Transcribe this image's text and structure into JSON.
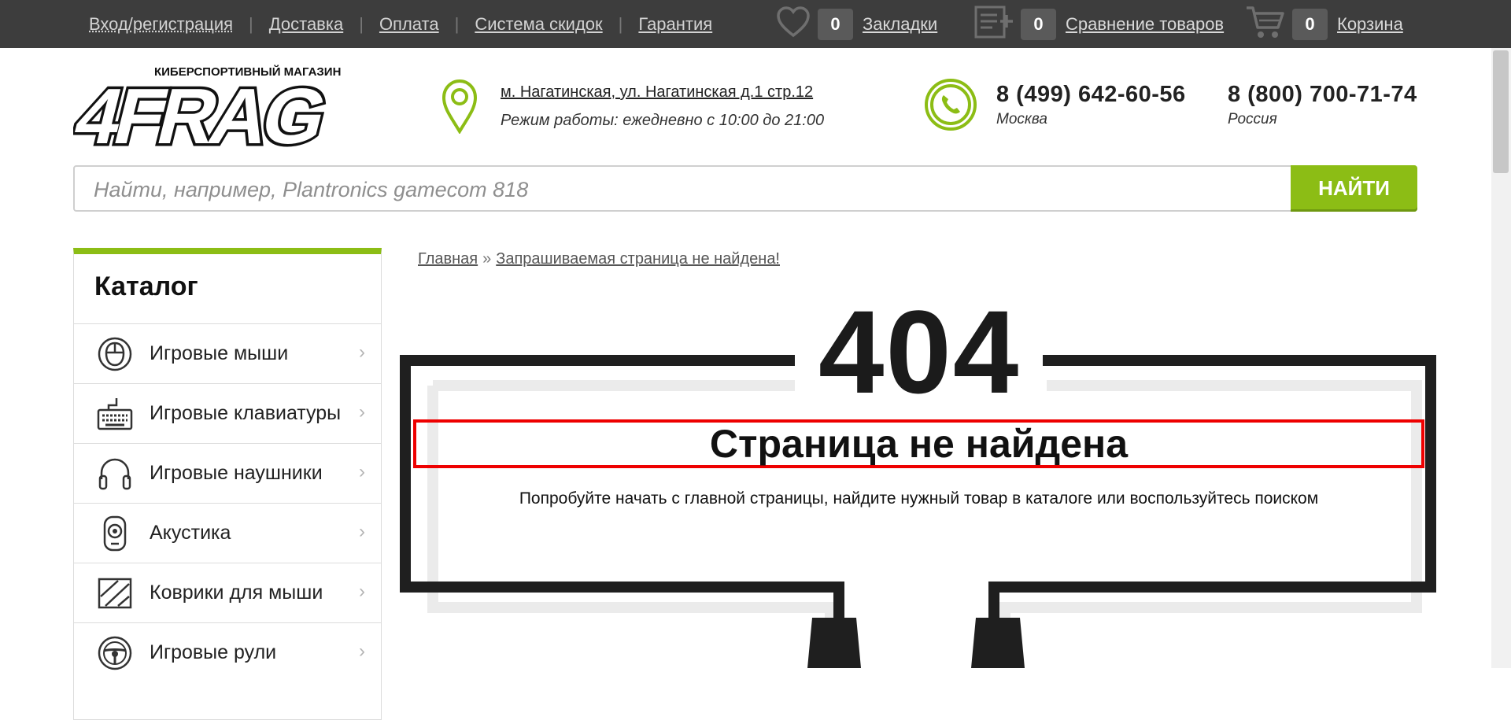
{
  "topbar": {
    "links": [
      "Вход/регистрация",
      "Доставка",
      "Оплата",
      "Система скидок",
      "Гарантия"
    ],
    "bookmarks": {
      "count": "0",
      "label": "Закладки"
    },
    "compare": {
      "count": "0",
      "label": "Сравнение товаров"
    },
    "cart": {
      "count": "0",
      "label": "Корзина"
    }
  },
  "header": {
    "logo_tagline": "КИБЕРСПОРТИВНЫЙ МАГАЗИН",
    "logo_text": "4FRAG",
    "address": "м. Нагатинская, ул. Нагатинская д.1 стр.12",
    "hours": "Режим работы: ежедневно с 10:00 до 21:00",
    "phone1": {
      "number": "8 (499) 642-60-56",
      "city": "Москва"
    },
    "phone2": {
      "number": "8 (800) 700-71-74",
      "city": "Россия"
    }
  },
  "search": {
    "placeholder": "Найти, например, Plantronics gamecom 818",
    "button": "НАЙТИ"
  },
  "catalog": {
    "title": "Каталог",
    "items": [
      {
        "label": "Игровые мыши",
        "icon": "mouse-icon"
      },
      {
        "label": "Игровые клавиатуры",
        "icon": "keyboard-icon"
      },
      {
        "label": "Игровые наушники",
        "icon": "headphones-icon"
      },
      {
        "label": "Акустика",
        "icon": "speaker-icon"
      },
      {
        "label": "Коврики для мыши",
        "icon": "mousepad-icon"
      },
      {
        "label": "Игровые рули",
        "icon": "steering-wheel-icon"
      }
    ]
  },
  "breadcrumb": {
    "home": "Главная",
    "separator": "»",
    "current": "Запрашиваемая страница не найдена!"
  },
  "error": {
    "code": "404",
    "title": "Страница не найдена",
    "description": "Попробуйте начать с главной страницы, найдите нужный товар в каталоге или воспользуйтесь поиском"
  },
  "colors": {
    "accent": "#8cbd15",
    "topbar": "#3d3d3d",
    "highlight_border": "#ee0000"
  }
}
